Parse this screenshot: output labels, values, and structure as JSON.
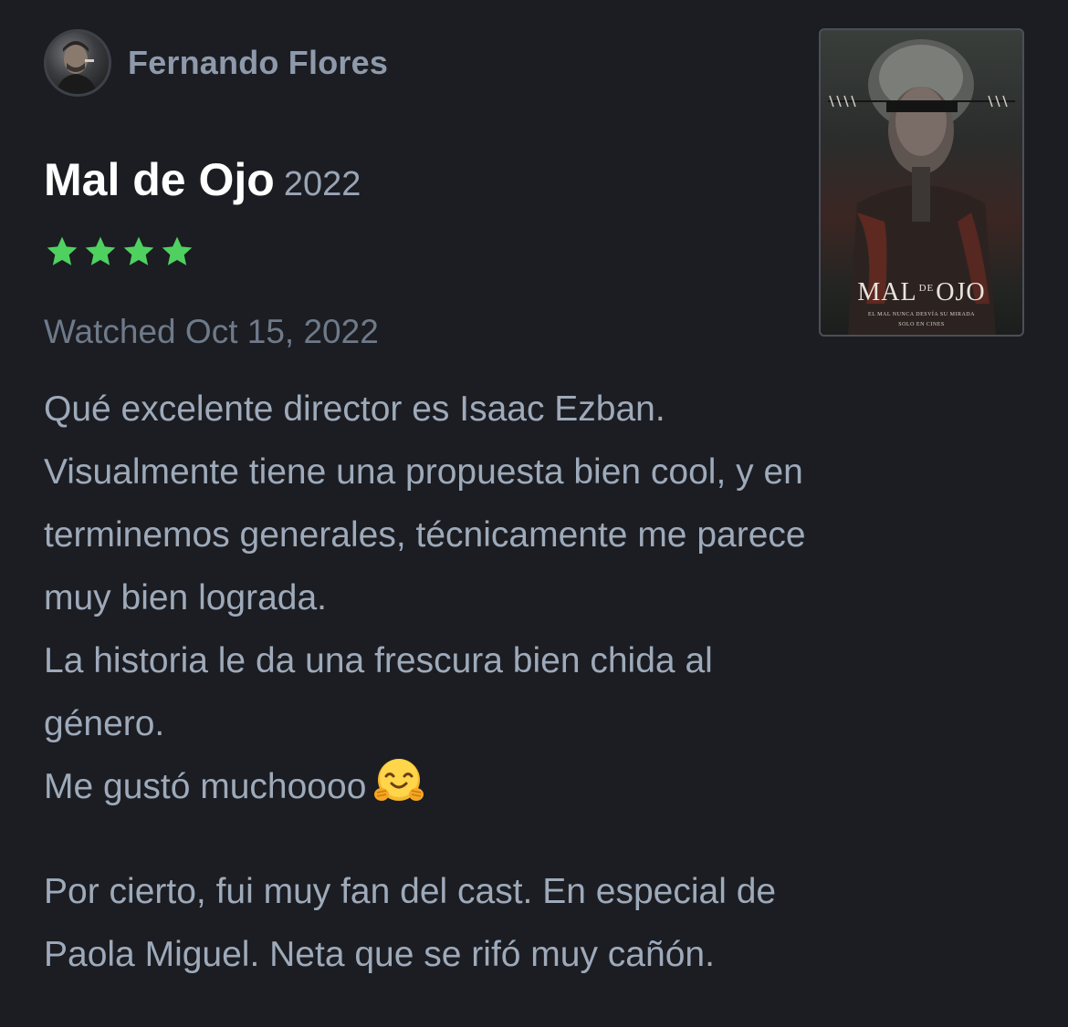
{
  "review": {
    "author": "Fernando Flores",
    "film": {
      "title": "Mal de Ojo",
      "year": "2022"
    },
    "rating": {
      "stars": 4,
      "max_stars": 5,
      "color": "#4fd160"
    },
    "watched": "Watched Oct 15, 2022",
    "body_lines": [
      "Qué excelente director es Isaac Ezban.",
      "Visualmente tiene una propuesta bien cool, y en",
      "terminemos generales, técnicamente me parece",
      "muy bien lograda.",
      "La historia le da una frescura bien chida al",
      "género.",
      "Me gustó muchoooo"
    ],
    "body_emoji": "hugging-face-emoji",
    "body_paragraph_2": [
      "Por cierto, fui muy fan del cast. En especial de",
      "Paola Miguel. Neta que se rifó muy cañón."
    ],
    "poster": {
      "title_left": "MAL",
      "title_small": "DE",
      "title_right": "OJO",
      "tagline": "EL MAL NUNCA DESVÍA SU MIRADA",
      "release": "SOLO EN CINES"
    }
  },
  "colors": {
    "background": "#1b1d22",
    "author": "#8e9aab",
    "title": "#ffffff",
    "body_text": "#9eaaba",
    "muted": "#6f7a89"
  }
}
